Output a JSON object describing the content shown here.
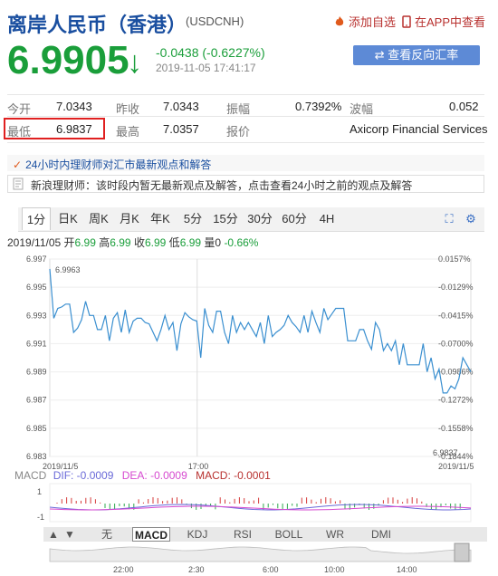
{
  "header": {
    "title": "离岸人民币（香港）",
    "code": "(USDCNH)",
    "fav_label": "添加自选",
    "app_label": "在APP中查看",
    "price": "6.9905",
    "change": "-0.0438 (-0.6227%)",
    "timestamp": "2019-11-05 17:41:17",
    "reverse_btn": "查看反向汇率"
  },
  "quote": {
    "open_label": "今开",
    "open": "7.0343",
    "prev_label": "昨收",
    "prev": "7.0343",
    "amp_label": "振幅",
    "amp": "0.7392%",
    "wave_label": "波幅",
    "wave": "0.052",
    "low_label": "最低",
    "low": "6.9837",
    "high_label": "最高",
    "high": "7.0357",
    "quote_label": "报价",
    "quote_src": "Axicorp Financial Services"
  },
  "news": {
    "headline": "24小时内理财师对汇市最新观点和解答",
    "line": "新浪理财师：该时段内暂无最新观点及解答，点击查看24小时之前的观点及解答"
  },
  "tabs": [
    "1分",
    "日K",
    "周K",
    "月K",
    "年K",
    "5分",
    "15分",
    "30分",
    "60分",
    "4H"
  ],
  "bar_info": {
    "date": "2019/11/05",
    "open_label": "开",
    "open": "6.99",
    "high_label": "高",
    "high": "6.99",
    "close_label": "收",
    "close": "6.99",
    "low_label": "低",
    "low": "6.99",
    "vol_label": "量",
    "vol": "0",
    "pct": "-0.66%"
  },
  "chart_data": {
    "type": "line",
    "y_ticks": [
      "6.997",
      "6.995",
      "6.993",
      "6.991",
      "6.989",
      "6.987",
      "6.985",
      "6.983"
    ],
    "pct_ticks": [
      "0.0157%",
      "-0.0129%",
      "-0.0415%",
      "-0.0700%",
      "-0.0986%",
      "-0.1272%",
      "-0.1558%",
      "-0.1844%"
    ],
    "x_ticks": [
      "2019/11/5",
      "17:00",
      "2019/11/5"
    ],
    "high_label": "6.9963",
    "low_label": "6.9837",
    "ylim": [
      6.983,
      6.997
    ],
    "values": [
      6.9963,
      6.9928,
      6.9935,
      6.9936,
      6.9938,
      6.9938,
      6.9918,
      6.9921,
      6.9927,
      6.994,
      6.993,
      6.993,
      6.992,
      6.992,
      6.993,
      6.9912,
      6.9928,
      6.9932,
      6.9918,
      6.9934,
      6.9918,
      6.9926,
      6.9928,
      6.9928,
      6.9925,
      6.9924,
      6.9918,
      6.9912,
      6.992,
      6.993,
      6.992,
      6.9925,
      6.9905,
      6.9924,
      6.9932,
      6.9929,
      6.9927,
      6.9926,
      6.99,
      6.9935,
      6.9923,
      6.9918,
      6.9933,
      6.9933,
      6.9918,
      6.991,
      6.993,
      6.9918,
      6.9925,
      6.992,
      6.9925,
      6.992,
      6.9915,
      6.9925,
      6.991,
      6.993,
      6.9915,
      6.9918,
      6.992,
      6.9923,
      6.993,
      6.9925,
      6.9922,
      6.9918,
      6.993,
      6.9918,
      6.9933,
      6.9925,
      6.9918,
      6.9935,
      6.9927,
      6.9931,
      6.9935,
      6.9935,
      6.9935,
      6.9912,
      6.9912,
      6.9912,
      6.992,
      6.992,
      6.9912,
      6.9906,
      6.9925,
      6.992,
      6.9905,
      6.991,
      6.9905,
      6.9912,
      6.9895,
      6.991,
      6.9895,
      6.9895,
      6.9895,
      6.9895,
      6.991,
      6.989,
      6.99,
      6.9885,
      6.9892,
      6.9875,
      6.9875,
      6.988,
      6.9878,
      6.9885,
      6.99,
      6.9895,
      6.989
    ]
  },
  "macd": {
    "label": "MACD",
    "dif": "DIF: -0.0009",
    "dea": "DEA: -0.0009",
    "macd": "MACD: -0.0001",
    "y_labels": [
      "1",
      "-1"
    ],
    "tabs": [
      "无",
      "MACD",
      "KDJ",
      "RSI",
      "BOLL",
      "WR",
      "DMI"
    ],
    "time_labels": [
      "22:00",
      "2:30",
      "6:00",
      "10:00",
      "14:00"
    ]
  }
}
